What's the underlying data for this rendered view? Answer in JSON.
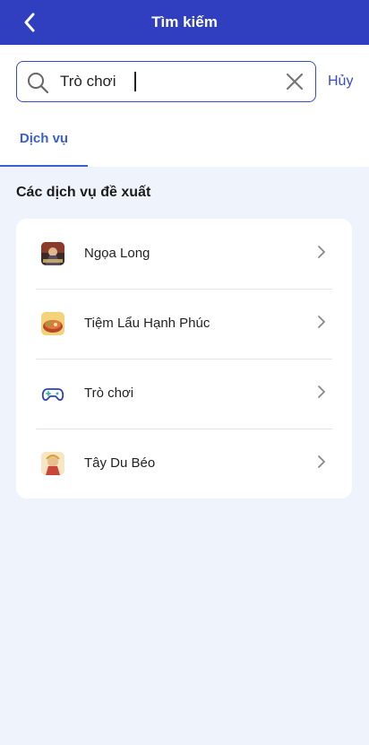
{
  "header": {
    "title": "Tìm kiếm"
  },
  "search": {
    "value": "Trò chơi",
    "cancel_label": "Hủy"
  },
  "tabs": [
    {
      "label": "Dịch vụ",
      "active": true
    }
  ],
  "section": {
    "title": "Các dịch vụ đề xuất"
  },
  "services": [
    {
      "label": "Ngọa Long",
      "icon": "ngoa-long-game-icon"
    },
    {
      "label": "Tiệm Lẩu Hạnh Phúc",
      "icon": "hotpot-game-icon"
    },
    {
      "label": "Trò chơi",
      "icon": "gamepad-icon"
    },
    {
      "label": "Tây Du Béo",
      "icon": "tay-du-game-icon"
    }
  ],
  "colors": {
    "brand": "#2f3fc0",
    "accent": "#3a5fd0",
    "background": "#eff3fb"
  }
}
